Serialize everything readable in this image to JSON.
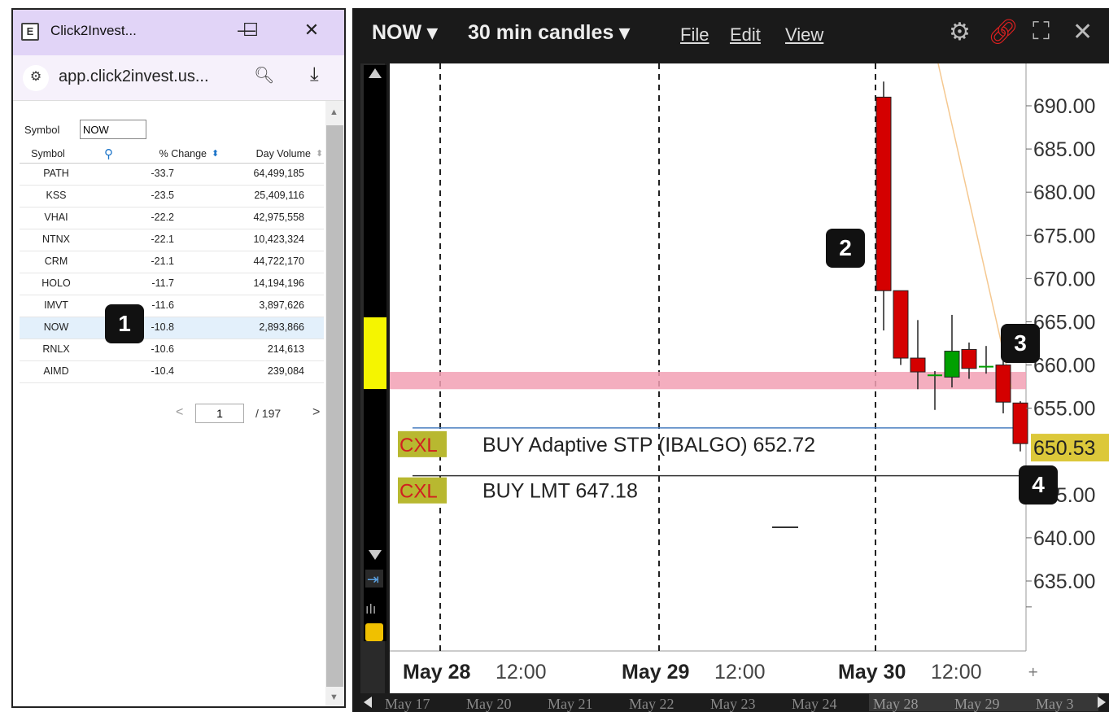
{
  "left_window": {
    "title": "Click2Invest...",
    "minimize": "—",
    "maximize": "☐",
    "close": "✕",
    "app_icon": "E",
    "url": "app.click2invest.us...",
    "tune_icon": "tune-icon",
    "zoom_icon": "magnifier-icon",
    "download_icon": "download-icon"
  },
  "scanner": {
    "symbol_label": "Symbol",
    "symbol_value": "NOW",
    "headers": {
      "symbol": "Symbol",
      "change": "% Change",
      "volume": "Day Volume"
    },
    "rows": [
      {
        "symbol": "PATH",
        "change": "-33.7",
        "volume": "64,499,185"
      },
      {
        "symbol": "KSS",
        "change": "-23.5",
        "volume": "25,409,116"
      },
      {
        "symbol": "VHAI",
        "change": "-22.2",
        "volume": "42,975,558"
      },
      {
        "symbol": "NTNX",
        "change": "-22.1",
        "volume": "10,423,324"
      },
      {
        "symbol": "CRM",
        "change": "-21.1",
        "volume": "44,722,170"
      },
      {
        "symbol": "HOLO",
        "change": "-11.7",
        "volume": "14,194,196"
      },
      {
        "symbol": "IMVT",
        "change": "-11.6",
        "volume": "3,897,626"
      },
      {
        "symbol": "NOW",
        "change": "-10.8",
        "volume": "2,893,866"
      },
      {
        "symbol": "RNLX",
        "change": "-10.6",
        "volume": "214,613"
      },
      {
        "symbol": "AIMD",
        "change": "-10.4",
        "volume": "239,084"
      }
    ],
    "pager": {
      "page": "1",
      "of": "/ 197",
      "prev": "<",
      "next": ">"
    }
  },
  "badges": {
    "b1": "1",
    "b2": "2",
    "b3": "3",
    "b4": "4"
  },
  "chart_window": {
    "symbol": "NOW ▾",
    "timeframe": "30 min candles ▾",
    "menu_file": "File",
    "menu_edit": "Edit",
    "menu_view": "View",
    "icons": [
      "gear-icon",
      "link-icon",
      "fullscreen-icon",
      "close-icon"
    ]
  },
  "chart_data": {
    "type": "candlestick",
    "ylim": [
      630,
      695
    ],
    "y_ticks": [
      "690.00",
      "685.00",
      "680.00",
      "675.00",
      "670.00",
      "665.00",
      "660.00",
      "655.00",
      "645.00",
      "640.00",
      "635.00"
    ],
    "last_price": "650.53",
    "x_labels": [
      {
        "day": "May 28",
        "time": "12:00"
      },
      {
        "day": "May 29",
        "time": "12:00"
      },
      {
        "day": "May 30",
        "time": "12:00"
      }
    ],
    "nav_dates": [
      "May 17",
      "May 20",
      "May 21",
      "May 22",
      "May 23",
      "May 24",
      "May 28",
      "May 29",
      "May 3"
    ],
    "candles": [
      {
        "open": 691,
        "high": 692.8,
        "low": 664,
        "close": 668.6
      },
      {
        "open": 668.6,
        "high": 668.6,
        "low": 660,
        "close": 660.8
      },
      {
        "open": 660.8,
        "high": 665.2,
        "low": 657.2,
        "close": 659.2
      },
      {
        "open": 658.8,
        "high": 659.3,
        "low": 654.8,
        "close": 658.8
      },
      {
        "open": 658.6,
        "high": 665.8,
        "low": 657.4,
        "close": 661.6
      },
      {
        "open": 661.8,
        "high": 662.6,
        "low": 658.4,
        "close": 659.6
      },
      {
        "open": 659.8,
        "high": 662.2,
        "low": 659.0,
        "close": 659.8
      },
      {
        "open": 660,
        "high": 661.6,
        "low": 654.4,
        "close": 655.7
      },
      {
        "open": 655.6,
        "high": 655.8,
        "low": 650,
        "close": 650.9
      }
    ],
    "orders": [
      {
        "tag": "CXL",
        "text": "BUY Adaptive STP (IBALGO) 652.72",
        "price": 652.72
      },
      {
        "tag": "CXL",
        "text": "BUY LMT 647.18",
        "price": 647.18
      }
    ],
    "resistance_zone": [
      657.2,
      659.2
    ],
    "colors": {
      "up": "#00a000",
      "down": "#d40000",
      "zone": "#f2a0b4",
      "stp_line": "#4a7fc0",
      "lmt_line": "#333333",
      "price_tag": "#dcc83a",
      "cxl_tag": "#b8b830"
    }
  }
}
